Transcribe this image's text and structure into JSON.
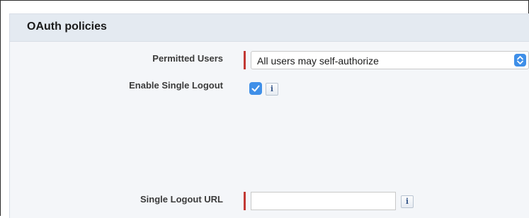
{
  "section": {
    "title": "OAuth policies"
  },
  "fields": {
    "permitted_users": {
      "label": "Permitted Users",
      "selected_value": "All users may self-authorize",
      "required": true
    },
    "enable_single_logout": {
      "label": "Enable Single Logout",
      "checked": true,
      "info_glyph": "i"
    },
    "single_logout_url": {
      "label": "Single Logout URL",
      "value": "",
      "required": true,
      "info_glyph": "i"
    }
  },
  "icons": {
    "stepper": "chevron-up-down-icon",
    "check": "checkmark-icon",
    "info": "info-icon"
  },
  "colors": {
    "required_marker": "#c23934",
    "accent_blue": "#3f8fe8",
    "header_bg": "#e4eaf1",
    "panel_bg": "#f4f6f9"
  }
}
